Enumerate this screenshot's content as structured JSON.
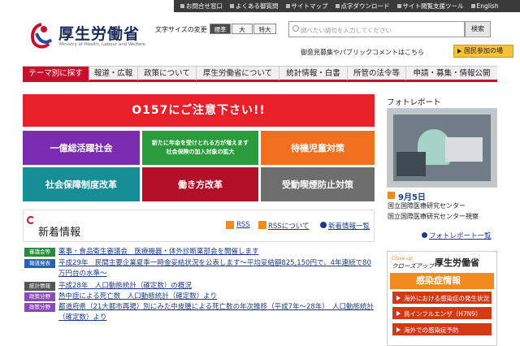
{
  "topbar": {
    "links": [
      "お問合せ窓口",
      "よくある御質問",
      "サイトマップ",
      "点字ダウンロード",
      "サイト閲覧支援ツール",
      "English"
    ]
  },
  "header": {
    "title": "厚生労働省",
    "subtitle": "Ministry of Health, Labour and Welfare",
    "font_size_label": "文字サイズの変更",
    "font_sizes": [
      "標準",
      "大",
      "特大"
    ],
    "search_placeholder": "調べたい語句を入力してください",
    "search_button": "検索",
    "opinion_link": "御意見募集やパブリックコメントはこちら",
    "participate_button": "国民参加の場"
  },
  "nav": {
    "items": [
      "テーマ別に探す",
      "報道・広報",
      "政策について",
      "厚生労働省について",
      "統計情報・白書",
      "所管の法令等",
      "申請・募集・情報公開"
    ]
  },
  "banners": {
    "main": "O157にご注意下さい!!",
    "tile1": "一億総活躍社会",
    "tile2_line1": "新たに年金を受けとれる方が増えます",
    "tile2_line2": "社会保険の加入対象の拡大",
    "tile3": "待機児童対策",
    "tile4": "社会保障制度改革",
    "tile5": "働き方改革",
    "tile6": "受動喫煙防止対策"
  },
  "news": {
    "title": "新着情報",
    "rss": "RSS",
    "rss_about": "RSSについて",
    "list_link": "新着情報一覧",
    "items": [
      {
        "tag": "審議会等",
        "text": "薬事・食品衛生審議会　医療機器・体外診断薬部会を開催します"
      },
      {
        "tag": "報道発表",
        "text": "平成29年　民間主要企業夏季一時金妥結状況を公表します〜平均妥結額825,150円で、4年連続で80万円台の水準〜"
      },
      {
        "tag": "統計情報",
        "text": "平成28年　人口動態統計（確定数）の概況"
      },
      {
        "tag": "政策分野",
        "text": "熱中症による死亡数　人口動態統計（確定数）より"
      },
      {
        "tag": "政策分野",
        "text": "都道府県（21大都市再掲）別にみた中皮腫による死亡数の年次推移（平成7年〜28年）　人口動態統計（確定数）より"
      }
    ]
  },
  "photo_report": {
    "title": "フォトレポート",
    "date": "9月5日",
    "caption1": "国立国際医療研究センター",
    "caption2": "国立国際医療研究センター視察",
    "list_link": "フォトレポート一覧"
  },
  "closeup": {
    "label_small": "Close up",
    "label": "クローズアップ",
    "title": "厚生労働省",
    "infection_title": "感染症情報",
    "buttons": [
      "海外における感染症の発生状況",
      "鳥インフルエンザ（H7N9）",
      "海外での感染症予防"
    ]
  }
}
